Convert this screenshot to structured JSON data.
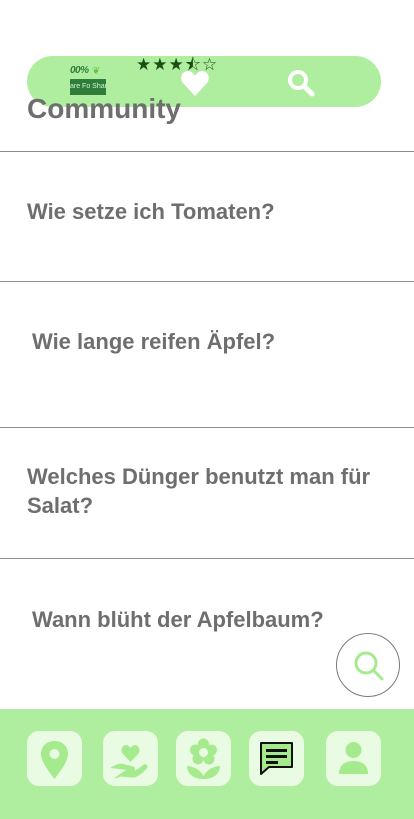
{
  "header": {
    "logo_top": "00%",
    "logo_bottom": "are Fo Share",
    "rating_stars": "★★★⯪☆",
    "rating_value": 3.5,
    "heart_icon": "heart-icon",
    "search_icon": "search-icon"
  },
  "page": {
    "title": "Community"
  },
  "questions": [
    "Wie setze ich Tomaten?",
    "Wie lange reifen Äpfel?",
    "Welches Dünger benutzt man für Salat?",
    "Wann blüht der Apfelbaum?"
  ],
  "fab": {
    "icon": "search-icon"
  },
  "bottom_nav": {
    "items": [
      {
        "icon": "location-pin-icon"
      },
      {
        "icon": "heart-hand-icon"
      },
      {
        "icon": "flower-icon"
      },
      {
        "icon": "chat-icon",
        "active": true
      },
      {
        "icon": "user-icon"
      }
    ]
  },
  "colors": {
    "accent_green": "#b0ee9f",
    "nav_button_bg": "#eafbe4",
    "icon_green": "#a6ea8e",
    "text_gray": "#6e6e6e",
    "logo_green": "#2f7d3a"
  }
}
